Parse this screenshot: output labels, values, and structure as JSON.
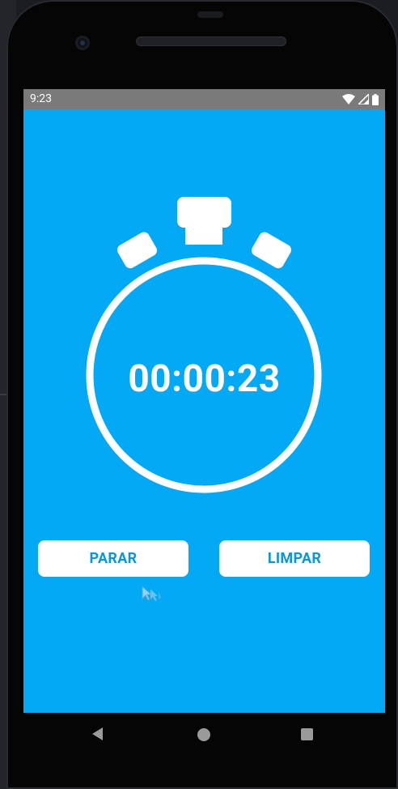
{
  "status_bar": {
    "time": "9:23",
    "icons": [
      "wifi-icon",
      "signal-icon",
      "battery-icon"
    ]
  },
  "stopwatch": {
    "time": "00:00:23",
    "icon": "stopwatch-icon"
  },
  "buttons": {
    "stop_label": "PARAR",
    "clear_label": "LIMPAR"
  },
  "navbar": {
    "icons": [
      "back-icon",
      "home-icon",
      "recents-icon"
    ]
  },
  "colors": {
    "screen_background": "#03a9f4",
    "button_background": "#ffffff",
    "button_text": "#0a96d8",
    "status_bar": "#7a7a7a"
  }
}
